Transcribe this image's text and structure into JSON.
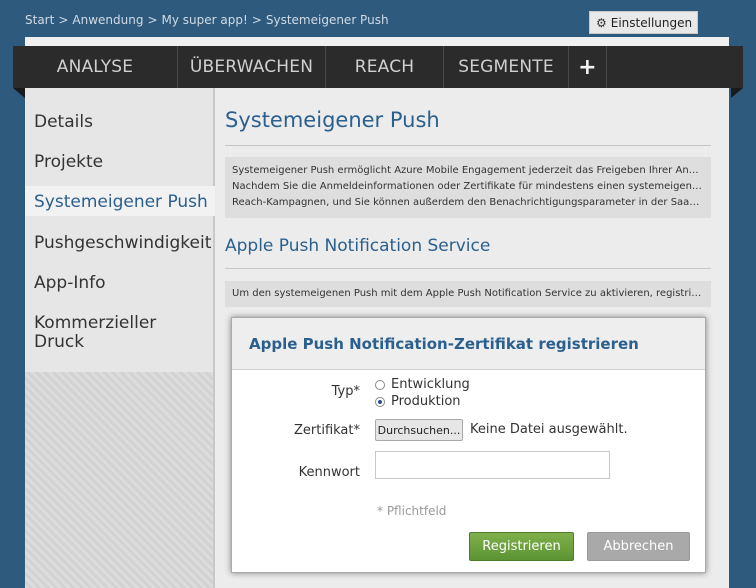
{
  "breadcrumb": {
    "items": [
      "Start",
      "Anwendung",
      "My super app!"
    ],
    "current": "Systemeigener Push",
    "separator": ">"
  },
  "settings": {
    "label": "Einstellungen",
    "icon": "gear-icon"
  },
  "nav": {
    "items": [
      "ANALYSE",
      "ÜBERWACHEN",
      "REACH",
      "SEGMENTE"
    ],
    "add_label": "+"
  },
  "sidebar": {
    "items": [
      {
        "label": "Details"
      },
      {
        "label": "Projekte"
      },
      {
        "label": "Systemeigener Push",
        "active": true
      },
      {
        "label": "Pushgeschwindigkeit"
      },
      {
        "label": "App-Info"
      },
      {
        "label": "Kommerzieller Druck"
      }
    ]
  },
  "main": {
    "title": "Systemeigener Push",
    "intro_lines": [
      "Systemeigener Push ermöglicht Azure Mobile Engagement jederzeit das Freigeben Ihrer Anwend...",
      "Nachdem Sie die Anmeldeinformationen oder Zertifikate für mindestens einen systemeigenen P...",
      "Reach-Kampagnen, und Sie können außerdem den Benachrichtigungsparameter in der SaaS-Pus..."
    ],
    "section_title": "Apple Push Notification Service",
    "section_info": "Um den systemeigenen Push mit dem Apple Push Notification Service zu aktivieren, registrieren..."
  },
  "dialog": {
    "title": "Apple Push Notification-Zertifikat registrieren",
    "type_label": "Typ*",
    "type_options": [
      {
        "label": "Entwicklung",
        "selected": false
      },
      {
        "label": "Produktion",
        "selected": true
      }
    ],
    "cert_label": "Zertifikat*",
    "browse_label": "Durchsuchen...",
    "file_status": "Keine Datei ausgewählt.",
    "password_label": "Kennwort",
    "password_value": "",
    "required_note": "* Pflichtfeld",
    "register_label": "Registrieren",
    "cancel_label": "Abbrechen"
  },
  "colors": {
    "background": "#2e5a7e",
    "accent": "#2a5f8e",
    "primary_button": "#6aa13d",
    "secondary_button": "#a9a9a9",
    "navbar": "#2b2b2b"
  }
}
